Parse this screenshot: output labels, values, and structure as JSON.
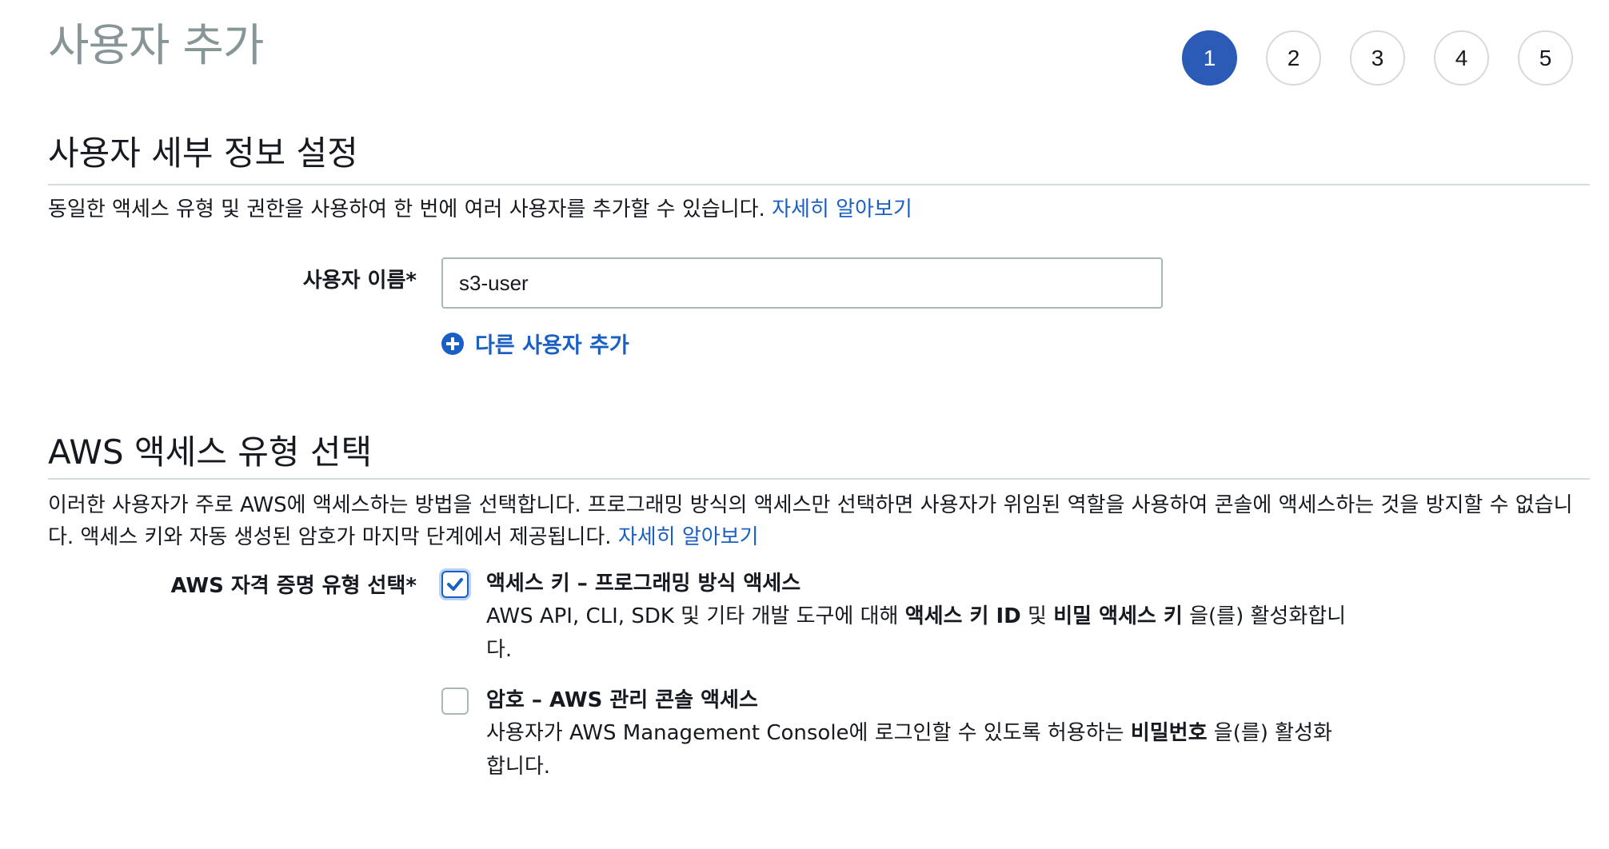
{
  "page": {
    "title": "사용자 추가"
  },
  "steps": [
    "1",
    "2",
    "3",
    "4",
    "5"
  ],
  "active_step": "1",
  "details_section": {
    "heading": "사용자 세부 정보 설정",
    "description": "동일한 액세스 유형 및 권한을 사용하여 한 번에 여러 사용자를 추가할 수 있습니다.",
    "learn_more": "자세히 알아보기",
    "username_label": "사용자 이름*",
    "username_value": "s3-user",
    "add_another_user": "다른 사용자 추가"
  },
  "access_section": {
    "heading": "AWS 액세스 유형 선택",
    "description": "이러한 사용자가 주로 AWS에 액세스하는 방법을 선택합니다. 프로그래밍 방식의 액세스만 선택하면 사용자가 위임된 역할을 사용하여 콘솔에 액세스하는 것을 방지할 수 없습니다. 액세스 키와 자동 생성된 암호가 마지막 단계에서 제공됩니다.",
    "learn_more": "자세히 알아보기",
    "credential_label": "AWS 자격 증명 유형 선택*",
    "options": [
      {
        "checked": true,
        "title": "액세스 키 – 프로그래밍 방식 액세스",
        "desc_prefix": "AWS API, CLI, SDK 및 기타 개발 도구에 대해 ",
        "desc_bold1": "액세스 키 ID",
        "desc_mid": " 및 ",
        "desc_bold2": "비밀 액세스 키",
        "desc_suffix": " 을(를) 활성화합니다."
      },
      {
        "checked": false,
        "title": "암호 – AWS 관리 콘솔 액세스",
        "desc_prefix": "사용자가 AWS Management Console에 로그인할 수 있도록 허용하는 ",
        "desc_bold1": "비밀번호",
        "desc_suffix": " 을(를) 활성화합니다."
      }
    ]
  },
  "colors": {
    "accent": "#1a5fc4",
    "step_active": "#2a5bb6",
    "title_gray": "#879596",
    "border": "#d5dbdb"
  }
}
